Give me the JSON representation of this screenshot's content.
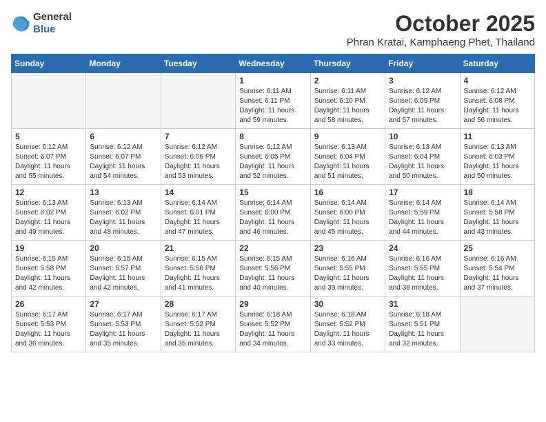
{
  "logo": {
    "general": "General",
    "blue": "Blue"
  },
  "header": {
    "title": "October 2025",
    "subtitle": "Phran Kratai, Kamphaeng Phet, Thailand"
  },
  "days_of_week": [
    "Sunday",
    "Monday",
    "Tuesday",
    "Wednesday",
    "Thursday",
    "Friday",
    "Saturday"
  ],
  "weeks": [
    [
      {
        "day": "",
        "info": ""
      },
      {
        "day": "",
        "info": ""
      },
      {
        "day": "",
        "info": ""
      },
      {
        "day": "1",
        "info": "Sunrise: 6:11 AM\nSunset: 6:11 PM\nDaylight: 11 hours\nand 59 minutes."
      },
      {
        "day": "2",
        "info": "Sunrise: 6:11 AM\nSunset: 6:10 PM\nDaylight: 11 hours\nand 58 minutes."
      },
      {
        "day": "3",
        "info": "Sunrise: 6:12 AM\nSunset: 6:09 PM\nDaylight: 11 hours\nand 57 minutes."
      },
      {
        "day": "4",
        "info": "Sunrise: 6:12 AM\nSunset: 6:08 PM\nDaylight: 11 hours\nand 56 minutes."
      }
    ],
    [
      {
        "day": "5",
        "info": "Sunrise: 6:12 AM\nSunset: 6:07 PM\nDaylight: 11 hours\nand 55 minutes."
      },
      {
        "day": "6",
        "info": "Sunrise: 6:12 AM\nSunset: 6:07 PM\nDaylight: 11 hours\nand 54 minutes."
      },
      {
        "day": "7",
        "info": "Sunrise: 6:12 AM\nSunset: 6:06 PM\nDaylight: 11 hours\nand 53 minutes."
      },
      {
        "day": "8",
        "info": "Sunrise: 6:12 AM\nSunset: 6:05 PM\nDaylight: 11 hours\nand 52 minutes."
      },
      {
        "day": "9",
        "info": "Sunrise: 6:13 AM\nSunset: 6:04 PM\nDaylight: 11 hours\nand 51 minutes."
      },
      {
        "day": "10",
        "info": "Sunrise: 6:13 AM\nSunset: 6:04 PM\nDaylight: 11 hours\nand 50 minutes."
      },
      {
        "day": "11",
        "info": "Sunrise: 6:13 AM\nSunset: 6:03 PM\nDaylight: 11 hours\nand 50 minutes."
      }
    ],
    [
      {
        "day": "12",
        "info": "Sunrise: 6:13 AM\nSunset: 6:02 PM\nDaylight: 11 hours\nand 49 minutes."
      },
      {
        "day": "13",
        "info": "Sunrise: 6:13 AM\nSunset: 6:02 PM\nDaylight: 11 hours\nand 48 minutes."
      },
      {
        "day": "14",
        "info": "Sunrise: 6:14 AM\nSunset: 6:01 PM\nDaylight: 11 hours\nand 47 minutes."
      },
      {
        "day": "15",
        "info": "Sunrise: 6:14 AM\nSunset: 6:00 PM\nDaylight: 11 hours\nand 46 minutes."
      },
      {
        "day": "16",
        "info": "Sunrise: 6:14 AM\nSunset: 6:00 PM\nDaylight: 11 hours\nand 45 minutes."
      },
      {
        "day": "17",
        "info": "Sunrise: 6:14 AM\nSunset: 5:59 PM\nDaylight: 11 hours\nand 44 minutes."
      },
      {
        "day": "18",
        "info": "Sunrise: 6:14 AM\nSunset: 5:58 PM\nDaylight: 11 hours\nand 43 minutes."
      }
    ],
    [
      {
        "day": "19",
        "info": "Sunrise: 6:15 AM\nSunset: 5:58 PM\nDaylight: 11 hours\nand 42 minutes."
      },
      {
        "day": "20",
        "info": "Sunrise: 6:15 AM\nSunset: 5:57 PM\nDaylight: 11 hours\nand 42 minutes."
      },
      {
        "day": "21",
        "info": "Sunrise: 6:15 AM\nSunset: 5:56 PM\nDaylight: 11 hours\nand 41 minutes."
      },
      {
        "day": "22",
        "info": "Sunrise: 6:15 AM\nSunset: 5:56 PM\nDaylight: 11 hours\nand 40 minutes."
      },
      {
        "day": "23",
        "info": "Sunrise: 6:16 AM\nSunset: 5:55 PM\nDaylight: 11 hours\nand 39 minutes."
      },
      {
        "day": "24",
        "info": "Sunrise: 6:16 AM\nSunset: 5:55 PM\nDaylight: 11 hours\nand 38 minutes."
      },
      {
        "day": "25",
        "info": "Sunrise: 6:16 AM\nSunset: 5:54 PM\nDaylight: 11 hours\nand 37 minutes."
      }
    ],
    [
      {
        "day": "26",
        "info": "Sunrise: 6:17 AM\nSunset: 5:53 PM\nDaylight: 11 hours\nand 36 minutes."
      },
      {
        "day": "27",
        "info": "Sunrise: 6:17 AM\nSunset: 5:53 PM\nDaylight: 11 hours\nand 35 minutes."
      },
      {
        "day": "28",
        "info": "Sunrise: 6:17 AM\nSunset: 5:52 PM\nDaylight: 11 hours\nand 35 minutes."
      },
      {
        "day": "29",
        "info": "Sunrise: 6:18 AM\nSunset: 5:52 PM\nDaylight: 11 hours\nand 34 minutes."
      },
      {
        "day": "30",
        "info": "Sunrise: 6:18 AM\nSunset: 5:52 PM\nDaylight: 11 hours\nand 33 minutes."
      },
      {
        "day": "31",
        "info": "Sunrise: 6:18 AM\nSunset: 5:51 PM\nDaylight: 11 hours\nand 32 minutes."
      },
      {
        "day": "",
        "info": ""
      }
    ]
  ]
}
